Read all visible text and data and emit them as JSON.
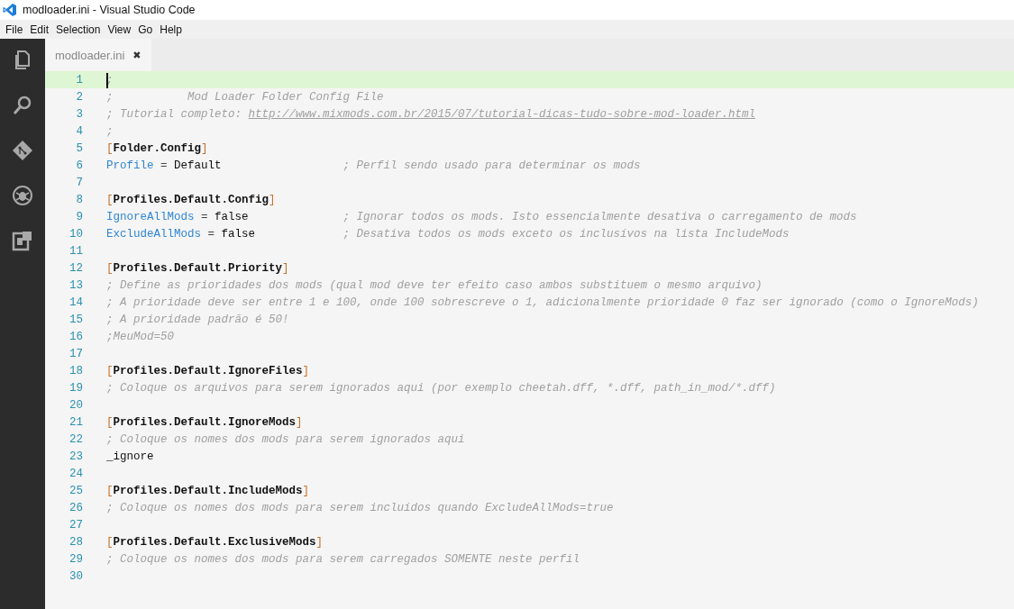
{
  "window": {
    "title": "modloader.ini - Visual Studio Code"
  },
  "menu": [
    "File",
    "Edit",
    "Selection",
    "View",
    "Go",
    "Help"
  ],
  "activity_bar": [
    {
      "kind": "files",
      "selected": false
    },
    {
      "kind": "search",
      "selected": false
    },
    {
      "kind": "git",
      "selected": false
    },
    {
      "kind": "debug",
      "selected": false
    },
    {
      "kind": "extensions",
      "selected": false
    }
  ],
  "tabs": [
    {
      "label": "modloader.ini",
      "close": "✖",
      "selected": true
    }
  ],
  "editor": {
    "lines": [
      {
        "number": "1",
        "current": true,
        "tokens": [
          {
            "kind": "comment",
            "text": ";"
          }
        ]
      },
      {
        "number": "2",
        "current": false,
        "tokens": [
          {
            "kind": "comment",
            "text": ";           Mod Loader Folder Config File"
          }
        ]
      },
      {
        "number": "3",
        "current": false,
        "tokens": [
          {
            "kind": "comment",
            "text": "; Tutorial completo: "
          },
          {
            "kind": "link",
            "text": "http://www.mixmods.com.br/2015/07/tutorial-dicas-tudo-sobre-mod-loader.html"
          }
        ]
      },
      {
        "number": "4",
        "current": false,
        "tokens": [
          {
            "kind": "comment",
            "text": ";"
          }
        ]
      },
      {
        "number": "5",
        "current": false,
        "tokens": [
          {
            "kind": "bracket",
            "text": "["
          },
          {
            "kind": "section",
            "text": "Folder.Config"
          },
          {
            "kind": "bracket",
            "text": "]"
          }
        ]
      },
      {
        "number": "6",
        "current": false,
        "tokens": [
          {
            "kind": "key",
            "text": "Profile"
          },
          {
            "kind": "op",
            "text": "="
          },
          {
            "kind": "value",
            "text": "Default"
          },
          {
            "kind": "comment",
            "text": "; Perfil sendo usado para determinar os mods"
          }
        ]
      },
      {
        "number": "7",
        "current": false
      },
      {
        "number": "8",
        "current": false,
        "tokens": [
          {
            "kind": "bracket",
            "text": "["
          },
          {
            "kind": "section",
            "text": "Profiles.Default.Config"
          },
          {
            "kind": "bracket",
            "text": "]"
          }
        ]
      },
      {
        "number": "9",
        "current": false,
        "tokens": [
          {
            "kind": "key",
            "text": "IgnoreAllMods"
          },
          {
            "kind": "op",
            "text": "="
          },
          {
            "kind": "value",
            "text": "false"
          },
          {
            "kind": "comment",
            "text": "; Ignorar todos os mods. Isto essencialmente desativa o carregamento de mods"
          }
        ]
      },
      {
        "number": "10",
        "current": false,
        "tokens": [
          {
            "kind": "key",
            "text": "ExcludeAllMods"
          },
          {
            "kind": "op",
            "text": "="
          },
          {
            "kind": "value",
            "text": "false"
          },
          {
            "kind": "comment",
            "text": "; Desativa todos os mods exceto os inclusívos na lista IncludeMods"
          }
        ]
      },
      {
        "number": "11",
        "current": false
      },
      {
        "number": "12",
        "current": false,
        "tokens": [
          {
            "kind": "bracket",
            "text": "["
          },
          {
            "kind": "section",
            "text": "Profiles.Default.Priority"
          },
          {
            "kind": "bracket",
            "text": "]"
          }
        ]
      },
      {
        "number": "13",
        "current": false,
        "tokens": [
          {
            "kind": "comment",
            "text": "; Define as prioridades dos mods (qual mod deve ter efeito caso ambos substituem o mesmo arquivo)"
          }
        ]
      },
      {
        "number": "14",
        "current": false,
        "tokens": [
          {
            "kind": "comment",
            "text": "; A prioridade deve ser entre 1 e 100, onde 100 sobrescreve o 1, adicionalmente prioridade 0 faz ser ignorado (como o IgnoreMods)"
          }
        ]
      },
      {
        "number": "15",
        "current": false,
        "tokens": [
          {
            "kind": "comment",
            "text": "; A prioridade padrão é 50!"
          }
        ]
      },
      {
        "number": "16",
        "current": false,
        "tokens": [
          {
            "kind": "comment",
            "text": ";MeuMod=50"
          }
        ]
      },
      {
        "number": "17",
        "current": false
      },
      {
        "number": "18",
        "current": false,
        "tokens": [
          {
            "kind": "bracket",
            "text": "["
          },
          {
            "kind": "section",
            "text": "Profiles.Default.IgnoreFiles"
          },
          {
            "kind": "bracket",
            "text": "]"
          }
        ]
      },
      {
        "number": "19",
        "current": false,
        "tokens": [
          {
            "kind": "comment",
            "text": "; Coloque os arquivos para serem ignorados aqui (por exemplo cheetah.dff, *.dff, path_in_mod/*.dff)"
          }
        ]
      },
      {
        "number": "20",
        "current": false
      },
      {
        "number": "21",
        "current": false,
        "tokens": [
          {
            "kind": "bracket",
            "text": "["
          },
          {
            "kind": "section",
            "text": "Profiles.Default.IgnoreMods"
          },
          {
            "kind": "bracket",
            "text": "]"
          }
        ]
      },
      {
        "number": "22",
        "current": false,
        "tokens": [
          {
            "kind": "comment",
            "text": "; Coloque os nomes dos mods para serem ignorados aqui"
          }
        ]
      },
      {
        "number": "23",
        "current": false,
        "tokens": [
          {
            "kind": "value",
            "text": "_ignore"
          }
        ]
      },
      {
        "number": "24",
        "current": false
      },
      {
        "number": "25",
        "current": false,
        "tokens": [
          {
            "kind": "bracket",
            "text": "["
          },
          {
            "kind": "section",
            "text": "Profiles.Default.IncludeMods"
          },
          {
            "kind": "bracket",
            "text": "]"
          }
        ]
      },
      {
        "number": "26",
        "current": false,
        "tokens": [
          {
            "kind": "comment",
            "text": "; Coloque os nomes dos mods para serem incluídos quando ExcludeAllMods=true"
          }
        ]
      },
      {
        "number": "27",
        "current": false
      },
      {
        "number": "28",
        "current": false,
        "tokens": [
          {
            "kind": "bracket",
            "text": "["
          },
          {
            "kind": "section",
            "text": "Profiles.Default.ExclusiveMods"
          },
          {
            "kind": "bracket",
            "text": "]"
          }
        ]
      },
      {
        "number": "29",
        "current": false,
        "tokens": [
          {
            "kind": "comment",
            "text": "; Coloque os nomes dos mods para serem carregados SOMENTE neste perfil"
          }
        ]
      },
      {
        "number": "30",
        "current": false
      }
    ]
  }
}
